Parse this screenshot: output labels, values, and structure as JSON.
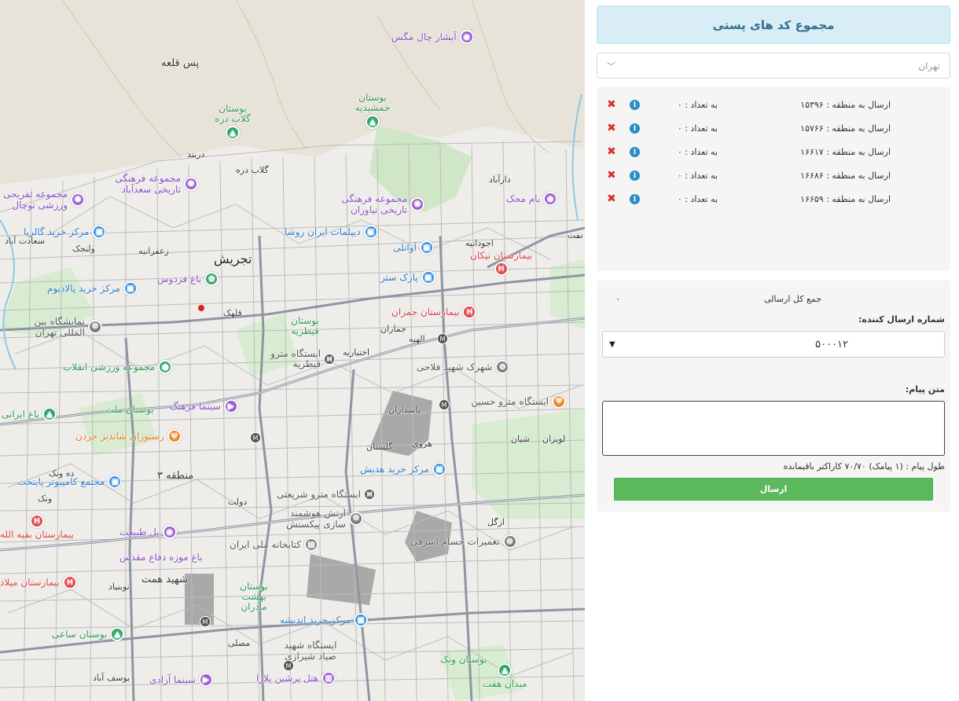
{
  "panel": {
    "title": "مجموع کد های پستی",
    "city_select": {
      "value": "تهران"
    },
    "zones": [
      {
        "send": "ارسال به منطقه : ۱۵۳۹۶",
        "count": "به تعداد : ۰"
      },
      {
        "send": "ارسال به منطقه : ۱۵۷۶۶",
        "count": "به تعداد : ۰"
      },
      {
        "send": "ارسال به منطقه : ۱۶۶۱۷",
        "count": "به تعداد : ۰"
      },
      {
        "send": "ارسال به منطقه : ۱۶۶۸۶",
        "count": "به تعداد : ۰"
      },
      {
        "send": "ارسال به منطقه : ۱۶۶۵۹",
        "count": "به تعداد : ۰"
      }
    ],
    "total_label": "جمع کل ارسالی",
    "total_value": "۰",
    "sender_label": "شماره ارسال کننده:",
    "sender_value": "۵۰۰۰۱۲",
    "message_label": "متن پیام:",
    "length_text": "طول پیام : (۱ پیامک) ۷۰/۷۰ کاراکتر باقیمانده",
    "send_button": "ارسال"
  },
  "map": {
    "pois": [
      {
        "name": "آبشار چال مگس",
        "icon": "camera-icon",
        "color": "purple"
      },
      {
        "name": "پس قلعه",
        "color": "plain"
      },
      {
        "name": "بوستان جمشیدیه",
        "color": "green"
      },
      {
        "name": "بوستان گلاب دره",
        "icon": "tree-icon",
        "color": "green"
      },
      {
        "name": "مجموعه فرهنگی تاریخی سعدآباد",
        "icon": "camera-icon",
        "color": "purple"
      },
      {
        "name": "مجموعه تفریحی ورزشی توچال",
        "icon": "camera-icon",
        "color": "purple"
      },
      {
        "name": "مرکز خرید گالریا",
        "icon": "shopping-icon",
        "color": "blue"
      },
      {
        "name": "مجموعه فرهنگی تاریخی نیاوران",
        "icon": "camera-icon",
        "color": "purple"
      },
      {
        "name": "بام محک",
        "icon": "camera-icon",
        "color": "purple"
      },
      {
        "name": "دیپلمات ایران روشا",
        "icon": "shopping-icon",
        "color": "blue"
      },
      {
        "name": "آواتلی",
        "icon": "shopping-icon",
        "color": "blue"
      },
      {
        "name": "بیمارستان نیکان",
        "icon": "hospital-icon",
        "color": "red"
      },
      {
        "name": "تجریش",
        "color": "plain"
      },
      {
        "name": "باغ فردوس",
        "icon": "park-icon",
        "color": "purple"
      },
      {
        "name": "پارک ستر",
        "icon": "shopping-icon",
        "color": "blue"
      },
      {
        "name": "مرکز خرید پالادیوم",
        "icon": "shopping-icon",
        "color": "blue"
      },
      {
        "name": "بیمارستان جمران",
        "icon": "hospital-icon",
        "color": "red"
      },
      {
        "name": "نمایشگاه بین المللی تهران",
        "icon": "gear-icon",
        "color": "gray"
      },
      {
        "name": "بوستان قیطریه",
        "color": "green"
      },
      {
        "name": "مجموعه ورزشی انقلاب",
        "icon": "pin-icon",
        "color": "green"
      },
      {
        "name": "ایستگاه مترو قیطریه",
        "icon": "metro-icon",
        "color": "gray"
      },
      {
        "name": "شهرک شهید فلاحی",
        "icon": "gear-icon",
        "color": "gray"
      },
      {
        "name": "بوستان ملت",
        "color": "green"
      },
      {
        "name": "سینما فرهنگ",
        "icon": "film-icon",
        "color": "purple"
      },
      {
        "name": "باغ ایرانی",
        "color": "green"
      },
      {
        "name": "رستوران شاندیز جردن",
        "icon": "food-icon",
        "color": "orange"
      },
      {
        "name": "ایستگاه مترو حسین",
        "icon": "food-icon",
        "color": "orange"
      },
      {
        "name": "مرکز خرید هدیش",
        "icon": "shopping-icon",
        "color": "blue"
      },
      {
        "name": "مجتمع کامپیوتر پایتخت",
        "icon": "shopping-icon",
        "color": "blue"
      },
      {
        "name": "ایستگاه مترو شریعتی",
        "icon": "metro-icon",
        "color": "gray"
      },
      {
        "name": "ارتش هوشمند سازی پیکسنش",
        "icon": "gear-icon",
        "color": "gray"
      },
      {
        "name": "بیمارستان بقیه الله",
        "icon": "hospital-icon",
        "color": "red"
      },
      {
        "name": "پل طبیعت",
        "icon": "camera-icon",
        "color": "purple"
      },
      {
        "name": "کتابخانه ملی ایران",
        "icon": "book-icon",
        "color": "gray"
      },
      {
        "name": "تعمیرات حسام اشرفی",
        "icon": "gear-icon",
        "color": "gray"
      },
      {
        "name": "باغ موزه دفاع مقدس",
        "color": "purple"
      },
      {
        "name": "بیمارستان میلاد",
        "icon": "hospital-icon",
        "color": "red"
      },
      {
        "name": "شهید همت",
        "color": "plain"
      },
      {
        "name": "بوستان بهشت مادران",
        "color": "green"
      },
      {
        "name": "مرکز خرید اندیشه",
        "icon": "shopping-icon",
        "color": "blue"
      },
      {
        "name": "بوستان ساعی",
        "icon": "tree-icon",
        "color": "green"
      },
      {
        "name": "ایستگاه شهید صیاد شیرازی",
        "color": "plain"
      },
      {
        "name": "سینما آزادی",
        "icon": "film-icon",
        "color": "purple"
      },
      {
        "name": "هتل پرشین پلازا",
        "icon": "hotel-icon",
        "color": "purple"
      },
      {
        "name": "بوستان ونک",
        "color": "green"
      },
      {
        "name": "میدان هفت",
        "icon": "tree-icon",
        "color": "green"
      }
    ],
    "labels": [
      {
        "text": "دربند"
      },
      {
        "text": "گلاب دره"
      },
      {
        "text": "زعفرانیه"
      },
      {
        "text": "ولنجک"
      },
      {
        "text": "دارآباد"
      },
      {
        "text": "اجودانیه"
      },
      {
        "text": "جماران"
      },
      {
        "text": "الهیه"
      },
      {
        "text": "اختیاریه"
      },
      {
        "text": "پاسداران"
      },
      {
        "text": "گلستان"
      },
      {
        "text": "هروی"
      },
      {
        "text": "ونک"
      },
      {
        "text": "یوسف آباد"
      },
      {
        "text": "مصلی"
      },
      {
        "text": "قلهک"
      },
      {
        "text": "ده ونک"
      },
      {
        "text": "سعادت آباد"
      },
      {
        "text": "دولت"
      },
      {
        "text": "منطقه ۳"
      },
      {
        "text": "نوبنیاد"
      },
      {
        "text": "لویزان"
      },
      {
        "text": "شیان"
      },
      {
        "text": "ازگل"
      },
      {
        "text": "نفت"
      }
    ]
  }
}
